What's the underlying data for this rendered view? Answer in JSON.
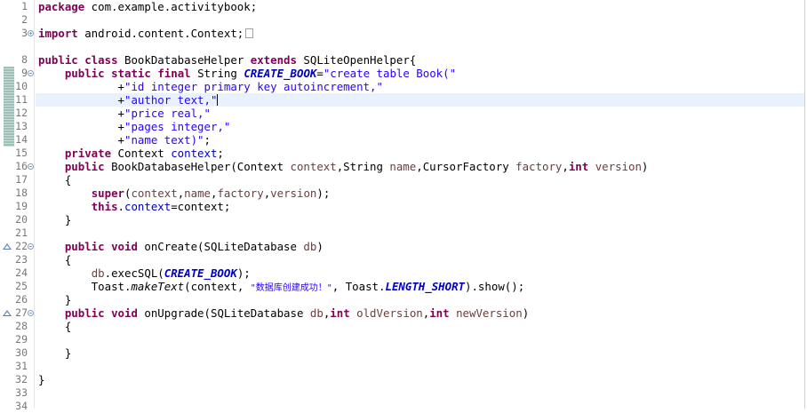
{
  "editor": {
    "current_line": "12",
    "lines": [
      {
        "n": "1"
      },
      {
        "n": "2"
      },
      {
        "n": "3"
      },
      {
        "n": "8"
      },
      {
        "n": "9"
      },
      {
        "n": "10"
      },
      {
        "n": "11"
      },
      {
        "n": "12"
      },
      {
        "n": "13"
      },
      {
        "n": "14"
      },
      {
        "n": "15"
      },
      {
        "n": "16"
      },
      {
        "n": "17"
      },
      {
        "n": "18"
      },
      {
        "n": "19"
      },
      {
        "n": "20"
      },
      {
        "n": "21"
      },
      {
        "n": "22"
      },
      {
        "n": "23"
      },
      {
        "n": "24"
      },
      {
        "n": "25"
      },
      {
        "n": "26"
      },
      {
        "n": "27"
      },
      {
        "n": "28"
      },
      {
        "n": "29"
      },
      {
        "n": "30"
      },
      {
        "n": "31"
      },
      {
        "n": "32"
      },
      {
        "n": "33"
      },
      {
        "n": "34"
      }
    ],
    "tokens": {
      "package_kw": "package",
      "package_name": " com.example.activitybook;",
      "import_kw": "import",
      "import_name": " android.content.Context;",
      "public": "public",
      "class": "class",
      "class_name": " BookDatabaseHelper ",
      "extends": "extends",
      "super_class": " SQLiteOpenHelper{",
      "static": "static",
      "final": "final",
      "string_type": " String ",
      "create_book": "CREATE_BOOK",
      "eq": "=",
      "s1": "\"create table Book(\"",
      "plus": "+",
      "s2": "\"id integer primary key autoincrement,\"",
      "s3": "\"author text,\"",
      "s4": "\"price real,\"",
      "s5": "\"pages integer,\"",
      "s6": "\"name text)\"",
      "semi": ";",
      "private": "private",
      "context_type": " Context ",
      "context_field": "context",
      "ctor_sig_a": " BookDatabaseHelper(Context ",
      "ctor_p1": "context",
      "ctor_sig_b": ",String ",
      "ctor_p2": "name",
      "ctor_sig_c": ",CursorFactory ",
      "ctor_p3": "factory",
      "ctor_sig_d": ",",
      "int": "int",
      "ctor_p4": "version",
      "ctor_sig_e": ")",
      "open_brace": "{",
      "close_brace": "}",
      "super": "super",
      "super_args_a": "(",
      "super_args_b": ",",
      "super_args_c": ");",
      "this": "this",
      "dot": ".",
      "assign_rest": "=context;",
      "void": "void",
      "oncreate_sig_a": " onCreate(SQLiteDatabase ",
      "db": "db",
      "exec_a": ".execSQL(",
      "exec_b": ");",
      "toast_a": "Toast.",
      "make_text": "makeText",
      "toast_b": "(context, ",
      "toast_msg": "\"数据库创建成功！\"",
      "toast_c": ", Toast.",
      "length_short": "LENGTH_SHORT",
      "toast_d": ").show();",
      "onupgrade_sig_a": " onUpgrade(SQLiteDatabase ",
      "old_version": "oldVersion",
      "new_version": "newVersion"
    }
  }
}
